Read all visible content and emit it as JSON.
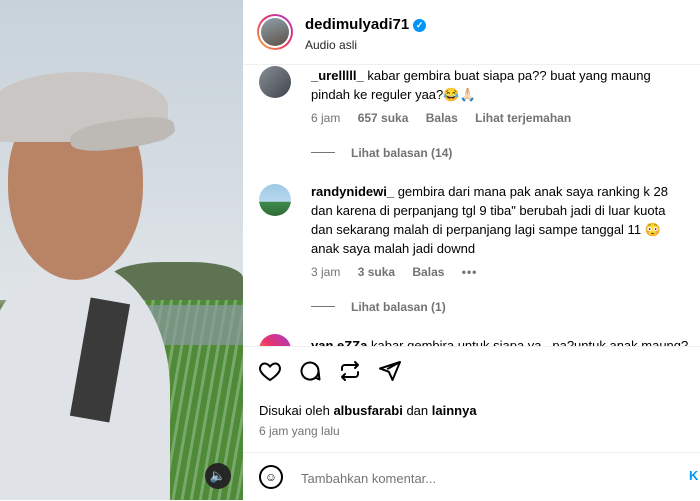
{
  "header": {
    "username": "dedimulyadi71",
    "audio": "Audio asli"
  },
  "comments": [
    {
      "username": "_urelllll_",
      "text": "kabar gembira buat siapa pa?? buat yang maung pindah ke reguler yaa?😂🙏🏻",
      "time": "6 jam",
      "likes": "657 suka",
      "reply": "Balas",
      "translate": "Lihat terjemahan",
      "view_replies": "Lihat balasan (14)"
    },
    {
      "username": "randynidewi_",
      "text": "gembira dari mana pak anak saya ranking k 28 dan karena di perpanjang tgl 9 tiba\" berubah jadi di luar kuota dan sekarang malah di perpanjang lagi sampe tanggal 11 😳 anak saya malah jadi downd",
      "time": "3 jam",
      "likes": "3 suka",
      "reply": "Balas",
      "more": "•••",
      "view_replies": "Lihat balasan (1)"
    },
    {
      "username": "yan.eZZa",
      "text": "kabar gembira untuk siapa ya...pa?untuk anak maung?"
    }
  ],
  "actions": {
    "liked_by_prefix": "Disukai oleh",
    "liked_by_user": "albusfarabi",
    "liked_by_and": "dan",
    "liked_by_others": "lainnya",
    "time_ago": "6 jam yang lalu"
  },
  "add_comment": {
    "placeholder": "Tambahkan komentar...",
    "post_label": "K"
  },
  "colors": {
    "link_blue": "#0095f6",
    "secondary_text": "#737373",
    "verified": "#0095f6"
  }
}
